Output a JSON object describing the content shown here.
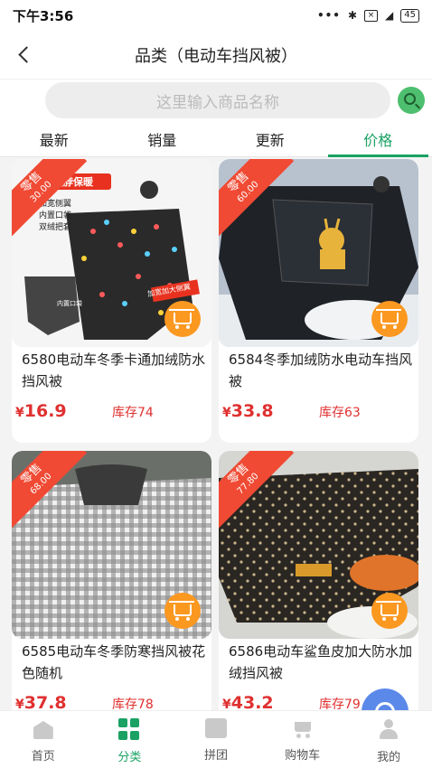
{
  "status_bar": {
    "time": "下午3:56",
    "dots": "•••",
    "battery": "45"
  },
  "header": {
    "title": "品类（电动车挡风被）"
  },
  "search": {
    "placeholder": "这里输入商品名称"
  },
  "tabs": [
    {
      "label": "最新"
    },
    {
      "label": "销量"
    },
    {
      "label": "更新"
    },
    {
      "label": "价格",
      "active": true
    }
  ],
  "products": [
    {
      "ribbon_title": "零售",
      "ribbon_price": "30.00",
      "name": "6580电动车冬季卡通加绒防水挡风被",
      "price": "16.9",
      "currency": "¥",
      "stock": "库存74",
      "image_text": [
        "围脖保暖",
        "加宽侧翼",
        "内置口袋",
        "双绒把套",
        "加宽加大侧翼",
        "内置口袋"
      ]
    },
    {
      "ribbon_title": "零售",
      "ribbon_price": "60.00",
      "name": "6584冬季加绒防水电动车挡风被",
      "price": "33.8",
      "currency": "¥",
      "stock": "库存63"
    },
    {
      "ribbon_title": "零售",
      "ribbon_price": "68.00",
      "name": "6585电动车冬季防寒挡风被花色随机",
      "price": "37.8",
      "currency": "¥",
      "stock": "库存78"
    },
    {
      "ribbon_title": "零售",
      "ribbon_price": "77.80",
      "name": "6586电动车鲨鱼皮加大防水加绒挡风被",
      "price": "43.2",
      "currency": "¥",
      "stock": "库存79"
    }
  ],
  "bottom_nav": [
    {
      "label": "首页",
      "icon": "home-icon"
    },
    {
      "label": "分类",
      "icon": "category-icon",
      "active": true
    },
    {
      "label": "拼团",
      "icon": "group-buy-icon"
    },
    {
      "label": "购物车",
      "icon": "cart-icon"
    },
    {
      "label": "我的",
      "icon": "profile-icon"
    }
  ],
  "colors": {
    "accent": "#1aa163",
    "price": "#e03030",
    "ribbon": "#f04a34",
    "cart_button": "#fb9820",
    "fab": "#4a7de8"
  }
}
